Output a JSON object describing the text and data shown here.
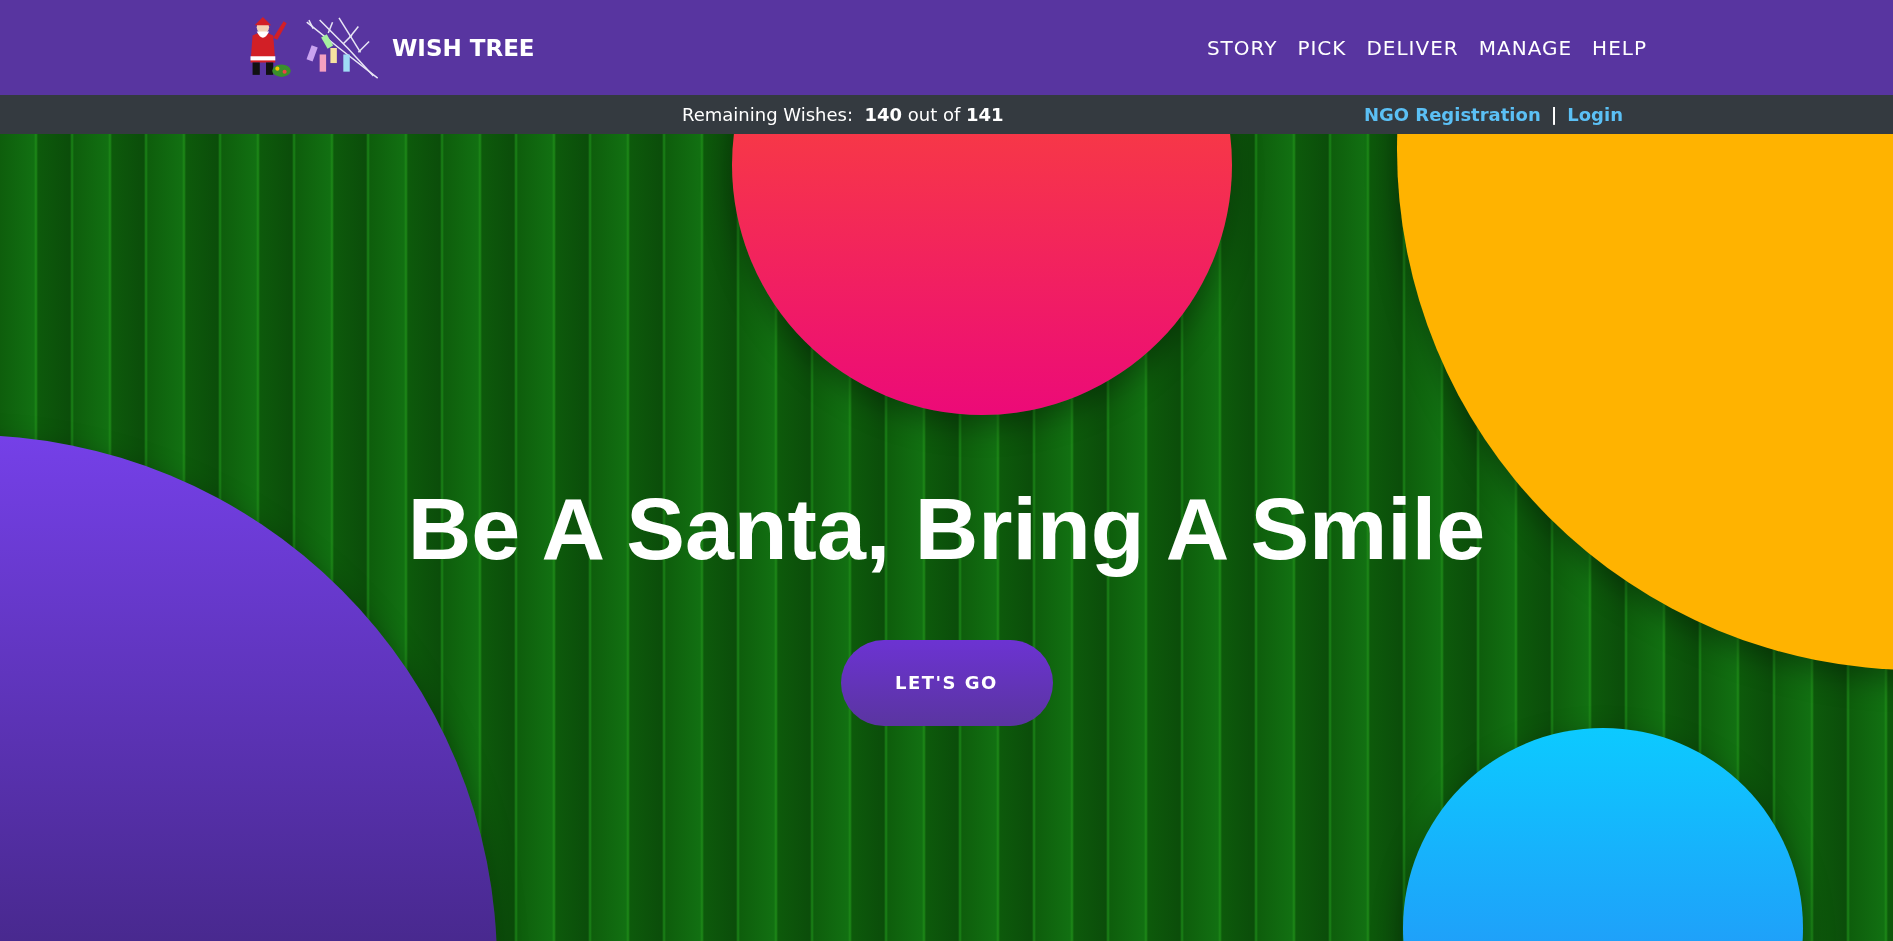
{
  "header": {
    "brand": "WISH TREE",
    "nav": [
      {
        "label": "STORY"
      },
      {
        "label": "PICK"
      },
      {
        "label": "DELIVER"
      },
      {
        "label": "MANAGE"
      },
      {
        "label": "HELP"
      }
    ]
  },
  "info_bar": {
    "remaining": "Remaining Wishes:  **140** out of **141**",
    "links": [
      "NGO Registration",
      "Login"
    ],
    "separator": "|"
  },
  "hero": {
    "headline": "Be A Santa, Bring A Smile",
    "button": "LET'S GO"
  }
}
